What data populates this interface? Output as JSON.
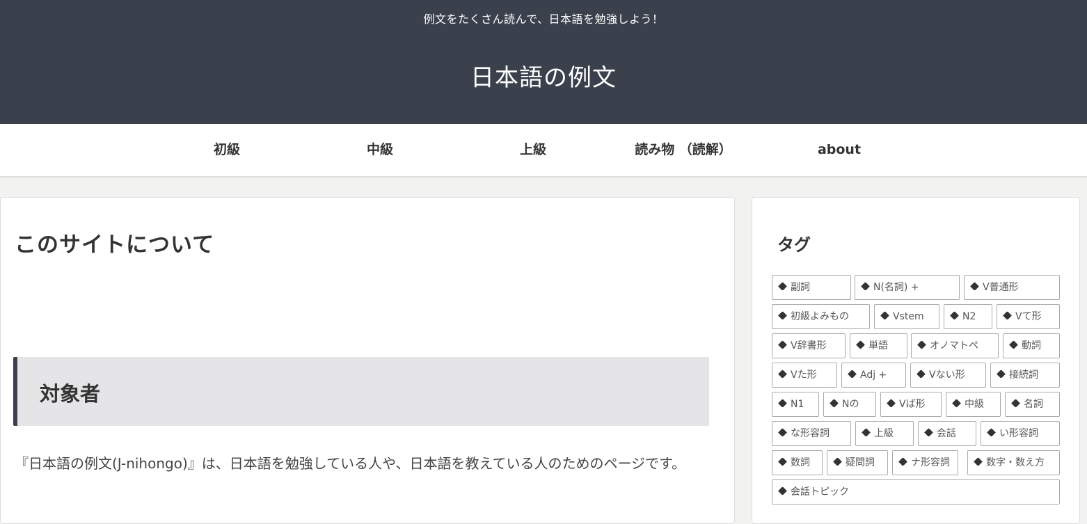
{
  "header": {
    "tagline": "例文をたくさん読んで、日本語を勉強しよう！",
    "site_title": "日本語の例文",
    "background": "#3b404d"
  },
  "nav": {
    "items": [
      {
        "label": "初級"
      },
      {
        "label": "中級"
      },
      {
        "label": "上級"
      },
      {
        "label": "読み物 （読解）"
      },
      {
        "label": "about"
      }
    ]
  },
  "main": {
    "title": "このサイトについて",
    "section_heading": "対象者",
    "paragraph": "『日本語の例文(J-nihongo)』は、日本語を勉強している人や、日本語を教えている人のためのページです。"
  },
  "sidebar": {
    "title": "タグ",
    "tag_icon": "tag-icon",
    "tags": [
      {
        "label": "副詞"
      },
      {
        "label": "N(名詞) +"
      },
      {
        "label": "V普通形"
      },
      {
        "label": "初級よみもの"
      },
      {
        "label": "Vstem"
      },
      {
        "label": "N2"
      },
      {
        "label": "Vて形"
      },
      {
        "label": "V辞書形"
      },
      {
        "label": "単語"
      },
      {
        "label": "オノマトペ"
      },
      {
        "label": "動詞"
      },
      {
        "label": "Vた形"
      },
      {
        "label": "Adj +"
      },
      {
        "label": "Vない形"
      },
      {
        "label": "接続詞"
      },
      {
        "label": "N1"
      },
      {
        "label": "Nの"
      },
      {
        "label": "Vば形"
      },
      {
        "label": "中級"
      },
      {
        "label": "名詞"
      },
      {
        "label": "な形容詞"
      },
      {
        "label": "上級"
      },
      {
        "label": "会話"
      },
      {
        "label": "い形容詞"
      },
      {
        "label": "数詞"
      },
      {
        "label": "疑問詞"
      },
      {
        "label": "ナ形容詞"
      },
      {
        "label": "数字・数え方"
      },
      {
        "label": "会話トピック"
      }
    ]
  }
}
